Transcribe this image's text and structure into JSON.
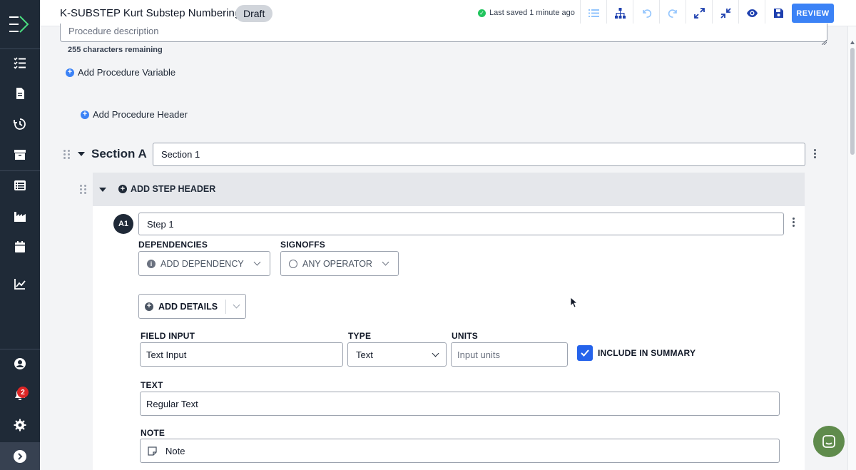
{
  "header": {
    "title": "K-SUBSTEP Kurt Substep Numbering",
    "status": "Draft",
    "saved_text": "Last saved 1 minute ago",
    "review_label": "REVIEW",
    "toolbar_icons": [
      "list-icon",
      "hierarchy-icon",
      "undo-icon",
      "redo-icon",
      "expand-icon",
      "collapse-icon",
      "eye-icon",
      "save-icon"
    ]
  },
  "sidebar": {
    "items": [
      "checklist-icon",
      "document-icon",
      "history-icon",
      "archive-icon",
      "list-details-icon",
      "factory-icon",
      "calendar-icon",
      "chart-icon"
    ],
    "bottom_items": [
      "user-icon",
      "notifications-icon",
      "settings-icon",
      "expand-sidebar-icon"
    ],
    "notification_count": "2"
  },
  "procedure": {
    "description_placeholder": "Procedure description",
    "chars_remaining": "255 characters remaining",
    "add_variable_label": "Add Procedure Variable",
    "add_header_label": "Add Procedure Header"
  },
  "section": {
    "label": "Section A",
    "name_value": "Section 1",
    "add_step_header_label": "ADD STEP HEADER"
  },
  "step": {
    "badge": "A1",
    "name_value": "Step 1",
    "dependencies_label": "DEPENDENCIES",
    "add_dependency_label": "ADD DEPENDENCY",
    "signoffs_label": "SIGNOFFS",
    "any_operator_label": "ANY OPERATOR",
    "add_details_label": "ADD DETAILS",
    "field_input_label": "FIELD INPUT",
    "field_input_value": "Text Input",
    "type_label": "TYPE",
    "type_value": "Text",
    "units_label": "UNITS",
    "units_placeholder": "Input units",
    "include_summary_label": "INCLUDE IN SUMMARY",
    "include_summary_checked": true,
    "text_label": "TEXT",
    "text_value": "Regular Text",
    "note_label": "NOTE",
    "note_value": "Note"
  },
  "colors": {
    "accent": "#3b82f6",
    "sidebar": "#1f2a37",
    "chat": "#5f8b4c"
  }
}
